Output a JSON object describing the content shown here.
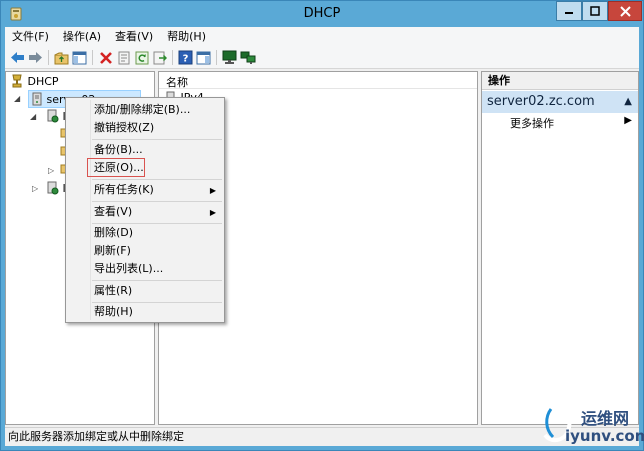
{
  "window": {
    "title": "DHCP"
  },
  "menubar": {
    "items": [
      "文件(F)",
      "操作(A)",
      "查看(V)",
      "帮助(H)"
    ]
  },
  "toolbar": {
    "icons": [
      "back-arrow-icon",
      "forward-arrow-icon",
      "folder-up-icon",
      "show-hide-tree-icon",
      "delete-icon",
      "properties-icon",
      "refresh-icon",
      "export-icon",
      "help-icon",
      "show-hide-action-pane-icon",
      "monitor-icon",
      "network-monitor-icon"
    ]
  },
  "tree": {
    "root": "DHCP",
    "server": "server02.zc.com",
    "child1": "IP",
    "child2": "IP"
  },
  "list": {
    "column_name": "名称",
    "row1": "IPv4"
  },
  "actions": {
    "header": "操作",
    "selected": "server02.zc.com",
    "more": "更多操作"
  },
  "context_menu": {
    "items": [
      {
        "label": "添加/删除绑定(B)..."
      },
      {
        "label": "撤销授权(Z)"
      },
      {
        "label": "备份(B)..."
      },
      {
        "label": "还原(O)..."
      },
      {
        "label": "所有任务(K)"
      },
      {
        "label": "查看(V)"
      },
      {
        "label": "删除(D)"
      },
      {
        "label": "刷新(F)"
      },
      {
        "label": "导出列表(L)..."
      },
      {
        "label": "属性(R)"
      },
      {
        "label": "帮助(H)"
      }
    ]
  },
  "statusbar": {
    "text": "向此服务器添加绑定或从中删除绑定"
  },
  "watermark": {
    "line1": "运维网",
    "line2": "iyunv.com"
  },
  "colors": {
    "titlebar": "#5aa9d6",
    "close": "#c7463c",
    "highlight": "#d9534f"
  }
}
